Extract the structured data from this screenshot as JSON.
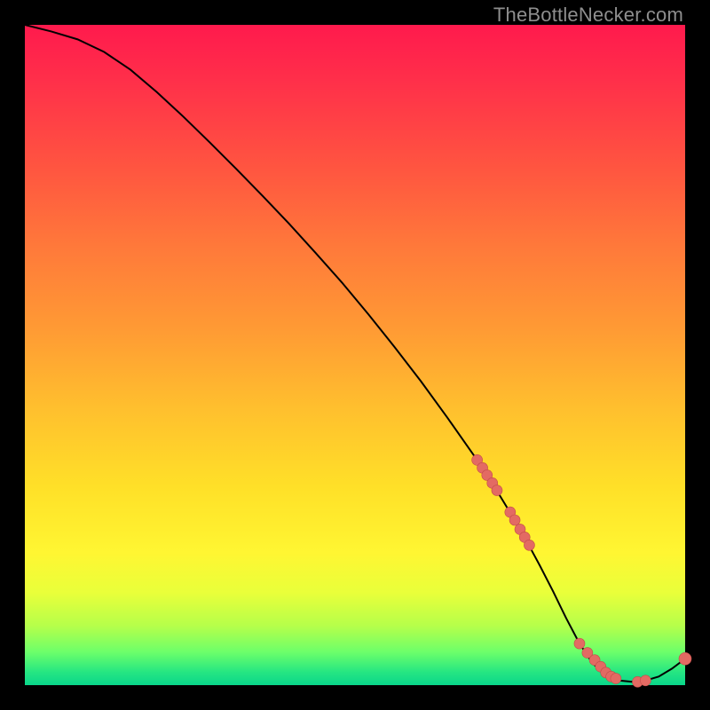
{
  "watermark": "TheBottleNecker.com",
  "colors": {
    "bg": "#000000",
    "curve": "#000000",
    "marker_fill": "#e36a63",
    "marker_stroke": "#c24a48"
  },
  "chart_data": {
    "type": "line",
    "title": "",
    "xlabel": "",
    "ylabel": "",
    "xlim": [
      0,
      100
    ],
    "ylim": [
      0,
      100
    ],
    "x": [
      0,
      4,
      8,
      12,
      16,
      20,
      24,
      28,
      32,
      36,
      40,
      44,
      48,
      52,
      56,
      60,
      64,
      68,
      70,
      72,
      74,
      76,
      78,
      80,
      82,
      84,
      86,
      88,
      90,
      92,
      94,
      96,
      98,
      100
    ],
    "y": [
      100,
      99,
      97.8,
      95.9,
      93.2,
      89.8,
      86.1,
      82.2,
      78.2,
      74.1,
      69.9,
      65.5,
      61.0,
      56.2,
      51.2,
      46.0,
      40.5,
      34.8,
      31.8,
      28.6,
      25.3,
      21.8,
      18.1,
      14.2,
      10.1,
      6.3,
      3.3,
      1.5,
      0.7,
      0.5,
      0.7,
      1.3,
      2.5,
      4.0
    ],
    "markers_upper": {
      "x": [
        68.5,
        69.3,
        70.0,
        70.8,
        71.5,
        73.5,
        74.2,
        75.0,
        75.7,
        76.4
      ],
      "y": [
        34.1,
        32.9,
        31.8,
        30.6,
        29.5,
        26.2,
        25.0,
        23.6,
        22.4,
        21.2
      ]
    },
    "markers_lower": {
      "x": [
        84.0,
        85.2,
        86.3,
        87.2,
        88.0,
        88.8,
        89.5,
        92.8,
        94.0
      ],
      "y": [
        6.3,
        4.9,
        3.8,
        2.8,
        1.9,
        1.3,
        1.0,
        0.5,
        0.7
      ]
    },
    "end_marker": {
      "x": 100,
      "y": 4.0
    }
  }
}
